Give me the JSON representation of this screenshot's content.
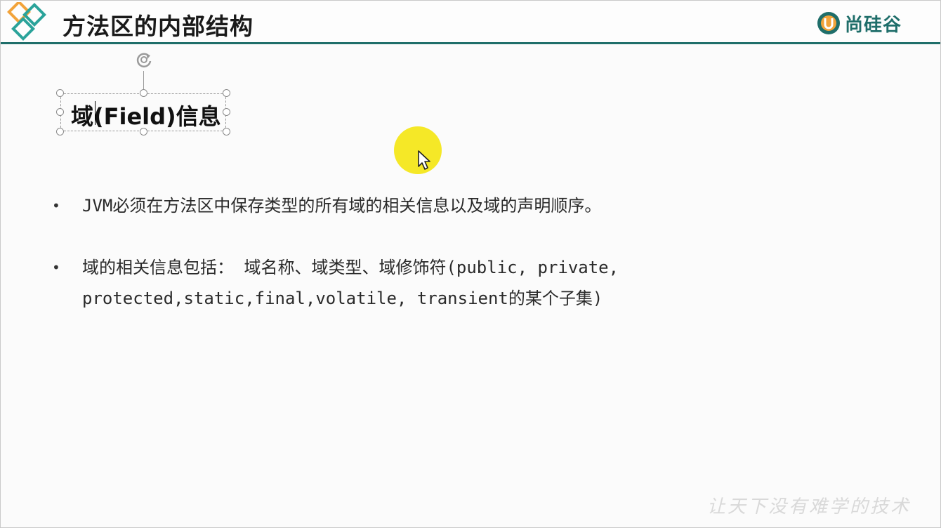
{
  "slide": {
    "title": "方法区的内部结构",
    "brand": "尚硅谷",
    "brand_icon_letter": "U",
    "logo_icon": "teal-orange-diamonds",
    "colors": {
      "accent": "#1f6e6a",
      "diamond_orange": "#f2a33a",
      "diamond_teal": "#2aa39a",
      "cursor_highlight": "#f4e615"
    }
  },
  "textbox": {
    "text": "域(Field)信息",
    "selected": true
  },
  "bullets": [
    {
      "text": "JVM必须在方法区中保存类型的所有域的相关信息以及域的声明顺序。"
    },
    {
      "line1": "域的相关信息包括： 域名称、域类型、域修饰符(public, private,",
      "line2": "protected,static,final,volatile, transient的某个子集)"
    }
  ],
  "bullet_symbol": "•",
  "watermark": "让天下没有难学的技术"
}
